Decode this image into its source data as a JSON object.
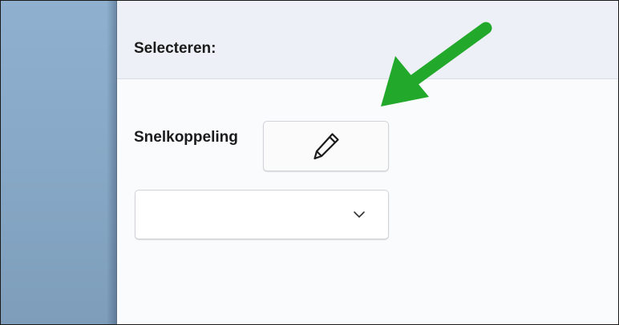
{
  "header": {
    "title": "Selecteren:"
  },
  "shortcut": {
    "label": "Snelkoppeling",
    "edit_icon": "pencil-icon",
    "dropdown_value": "",
    "dropdown_icon": "chevron-down-icon"
  },
  "annotation": {
    "arrow_color": "#22a82a"
  },
  "colors": {
    "header_bg": "#edf1f7",
    "panel_bg": "#fafbfd",
    "desktop_bg": "#8fb0cf"
  }
}
